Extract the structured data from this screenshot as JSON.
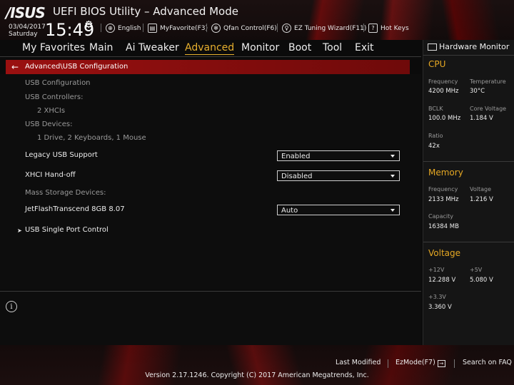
{
  "header": {
    "logo": "/ISUS",
    "title": "UEFI BIOS Utility – Advanced Mode",
    "date": "03/04/2017",
    "day": "Saturday",
    "time": "15:49",
    "tools": {
      "language": "English",
      "myfavorite": "MyFavorite(F3)",
      "qfan": "Qfan Control(F6)",
      "ez_tuning": "EZ Tuning Wizard(F11)",
      "hotkeys": "Hot Keys"
    }
  },
  "menu": {
    "items": [
      "My Favorites",
      "Main",
      "Ai Tweaker",
      "Advanced",
      "Monitor",
      "Boot",
      "Tool",
      "Exit"
    ],
    "active": "Advanced"
  },
  "breadcrumb": "Advanced\\USB Configuration",
  "content": {
    "usb_configuration": "USB Configuration",
    "usb_controllers_label": "USB Controllers:",
    "usb_controllers_value": "2 XHCIs",
    "usb_devices_label": "USB Devices:",
    "usb_devices_value": "1 Drive, 2 Keyboards, 1 Mouse",
    "legacy_usb_label": "Legacy USB Support",
    "legacy_usb_value": "Enabled",
    "xhci_label": "XHCI Hand-off",
    "xhci_value": "Disabled",
    "mass_storage_label": "Mass Storage Devices:",
    "jetflash_label": "JetFlashTranscend 8GB 8.07",
    "jetflash_value": "Auto",
    "single_port_label": "USB Single Port Control"
  },
  "hardware_monitor": {
    "title": "Hardware Monitor",
    "cpu": {
      "section": "CPU",
      "frequency_label": "Frequency",
      "frequency_value": "4200 MHz",
      "temperature_label": "Temperature",
      "temperature_value": "30°C",
      "bclk_label": "BCLK",
      "bclk_value": "100.0 MHz",
      "core_voltage_label": "Core Voltage",
      "core_voltage_value": "1.184 V",
      "ratio_label": "Ratio",
      "ratio_value": "42x"
    },
    "memory": {
      "section": "Memory",
      "frequency_label": "Frequency",
      "frequency_value": "2133 MHz",
      "voltage_label": "Voltage",
      "voltage_value": "1.216 V",
      "capacity_label": "Capacity",
      "capacity_value": "16384 MB"
    },
    "voltage": {
      "section": "Voltage",
      "v12_label": "+12V",
      "v12_value": "12.288 V",
      "v5_label": "+5V",
      "v5_value": "5.080 V",
      "v33_label": "+3.3V",
      "v33_value": "3.360 V"
    }
  },
  "footer": {
    "last_modified": "Last Modified",
    "ezmode": "EzMode(F7)",
    "search_faq": "Search on FAQ",
    "copyright": "Version 2.17.1246. Copyright (C) 2017 American Megatrends, Inc."
  },
  "colors": {
    "accent": "#e6b02e",
    "breadcrumb_bar": "#9a1010",
    "section_heading": "#e6a823"
  }
}
